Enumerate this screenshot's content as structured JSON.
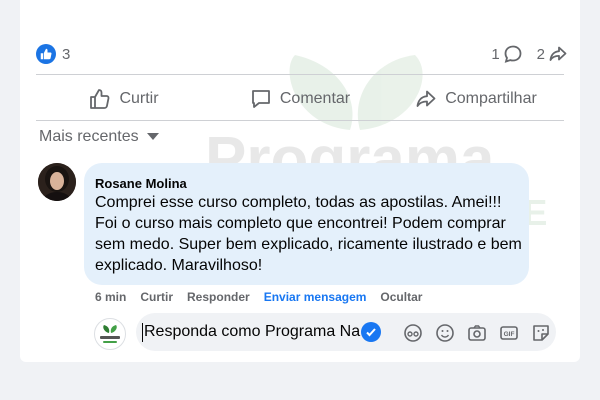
{
  "post": {
    "reactions": {
      "count": "3"
    },
    "stats": {
      "comments": "1",
      "shares": "2"
    },
    "actions": {
      "like": "Curtir",
      "comment": "Comentar",
      "share": "Compartilhar"
    },
    "sort": {
      "label": "Mais recentes"
    }
  },
  "watermark": {
    "line1": "Programa",
    "line2": "STORE"
  },
  "comment": {
    "author": "Rosane Molina",
    "text": "Comprei esse curso completo, todas as apostilas. Amei!!! Foi o curso mais completo que encontrei! Podem comprar sem medo. Super bem explicado, ricamente ilustrado e bem explicado. Maravilhoso!",
    "time": "6 min",
    "like": "Curtir",
    "reply": "Responder",
    "message": "Enviar mensagem",
    "hide": "Ocultar"
  },
  "reply_box": {
    "placeholder": "Responda como Programa Na"
  },
  "colors": {
    "accent": "#1877f2",
    "bubble": "#e4f0fb",
    "muted": "#65676b"
  }
}
